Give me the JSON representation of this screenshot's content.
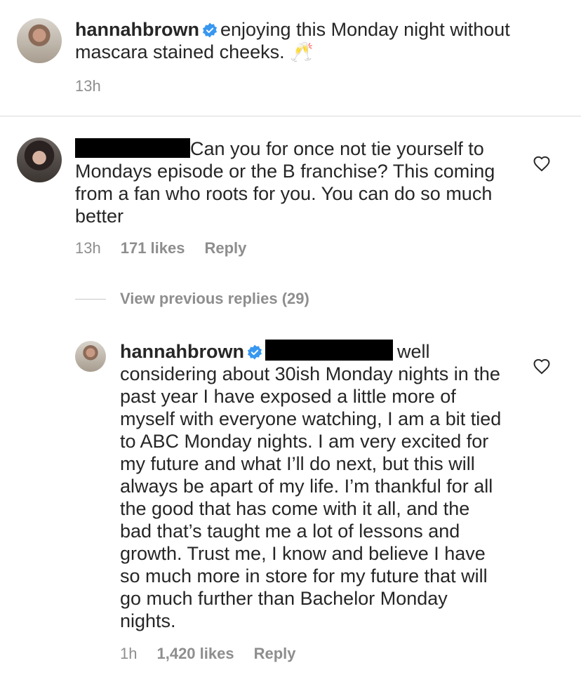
{
  "post": {
    "username": "hannahbrown",
    "caption": "enjoying this Monday night without mascara stained cheeks. 🥂",
    "time": "13h"
  },
  "comment": {
    "text": "Can you for once not tie yourself to Mondays episode or the B franchise? This coming from a fan who roots for you. You can do so much better",
    "time": "13h",
    "likes": "171 likes",
    "reply_label": "Reply"
  },
  "view_previous": {
    "label": "View previous replies (29)"
  },
  "reply": {
    "username": "hannahbrown",
    "text_first": "well",
    "text_rest": "considering about 30ish Monday nights in the past year I have exposed a little more of myself with everyone watching, I am a bit tied to ABC Monday nights. I am very excited for my future and what I’ll do next, but this will always be apart of my life. I’m thankful for all the good that has come with it all, and the bad that’s taught me a lot of lessons and growth. Trust me, I know and believe I have so much more in store for my future that will go much further than Bachelor Monday nights.",
    "time": "1h",
    "likes": "1,420 likes",
    "reply_label": "Reply"
  },
  "icons": {
    "verified": "verified-badge-icon",
    "like": "heart-icon"
  },
  "colors": {
    "verified_blue": "#3897f0",
    "meta_gray": "#8e8e8e",
    "text": "#262626"
  }
}
